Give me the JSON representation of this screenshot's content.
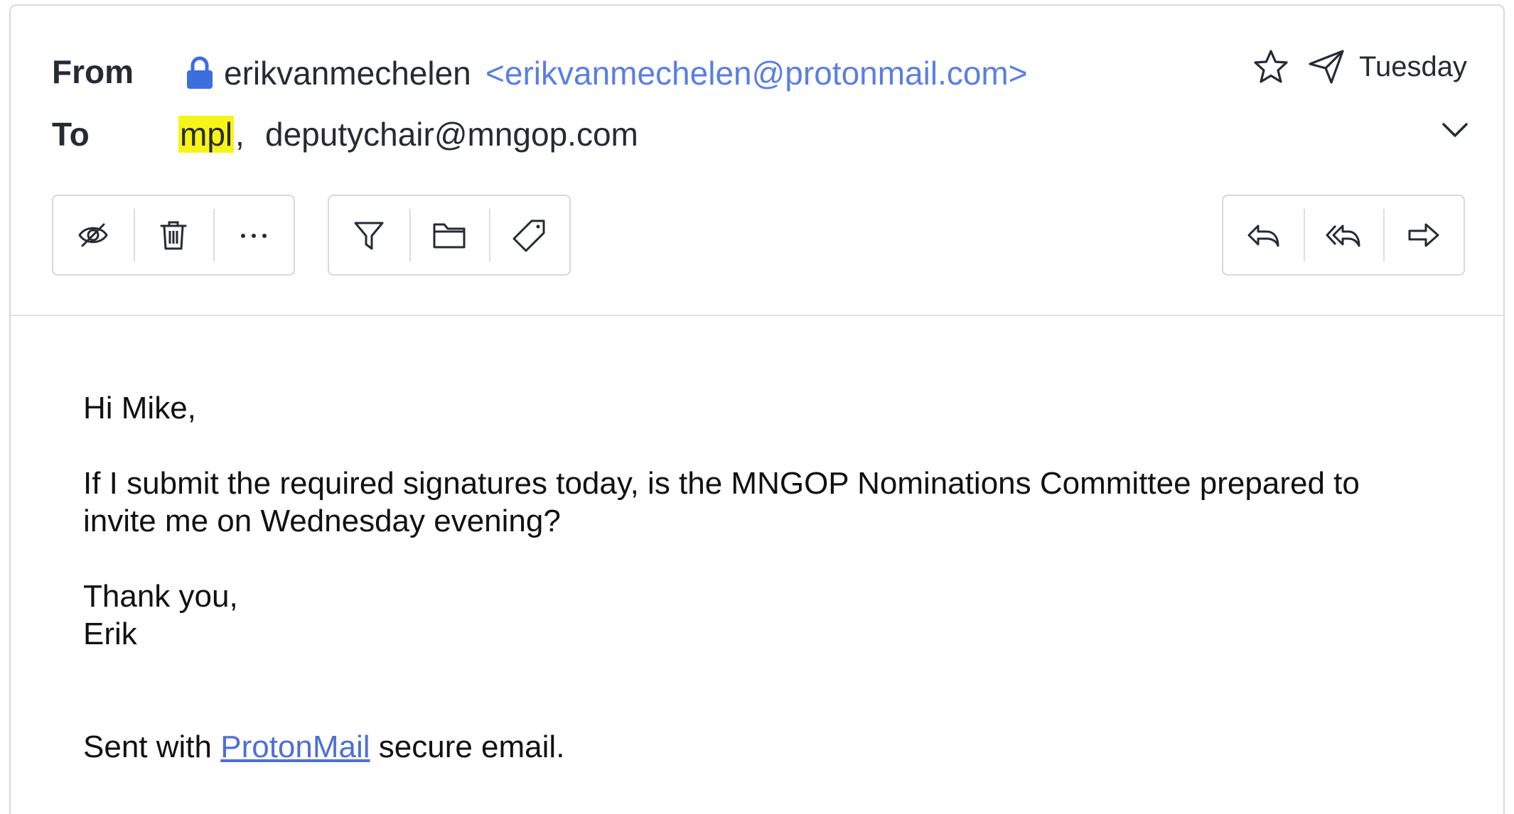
{
  "header": {
    "from_label": "From",
    "to_label": "To",
    "sender_name": "erikvanmechelen",
    "sender_email": "<erikvanmechelen@protonmail.com>",
    "recipients": [
      "mpl",
      "deputychair@mngop.com"
    ],
    "recipient_separator": ",",
    "date": "Tuesday",
    "icons": [
      "lock-icon",
      "star-icon",
      "sent-icon",
      "chevron-down-icon"
    ]
  },
  "toolbar": {
    "left_group": [
      "mark-unread-icon",
      "trash-icon",
      "more-icon"
    ],
    "middle_group": [
      "filter-icon",
      "folder-icon",
      "tag-icon"
    ],
    "right_group": [
      "reply-icon",
      "reply-all-icon",
      "forward-icon"
    ]
  },
  "message": {
    "greeting": "Hi Mike,",
    "line1": "If I submit the required signatures today, is the MNGOP Nominations Committee prepared to",
    "line2": "invite me on Wednesday evening?",
    "closing": "Thank you,",
    "signature_name": "Erik",
    "footer_prefix": "Sent with ",
    "footer_link": "ProtonMail",
    "footer_suffix": " secure email."
  },
  "colors": {
    "accent": "#5b7fe0",
    "link": "#4f6fd6",
    "highlight": "#f6f418",
    "lock": "#3c6ee0"
  }
}
